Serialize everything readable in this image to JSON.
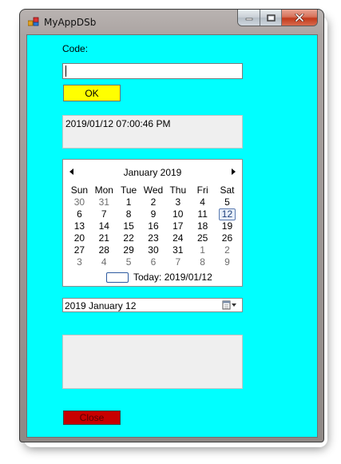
{
  "window": {
    "title": "MyAppDSb"
  },
  "form": {
    "code_label": "Code:",
    "code_value": "",
    "ok_label": "OK",
    "timestamp": "2019/01/12 07:00:46 PM",
    "close_label": "Close"
  },
  "calendar": {
    "month_title": "January 2019",
    "weekdays": [
      "Sun",
      "Mon",
      "Tue",
      "Wed",
      "Thu",
      "Fri",
      "Sat"
    ],
    "weeks": [
      [
        "30",
        "31",
        "1",
        "2",
        "3",
        "4",
        "5"
      ],
      [
        "6",
        "7",
        "8",
        "9",
        "10",
        "11",
        "12"
      ],
      [
        "13",
        "14",
        "15",
        "16",
        "17",
        "18",
        "19"
      ],
      [
        "20",
        "21",
        "22",
        "23",
        "24",
        "25",
        "26"
      ],
      [
        "27",
        "28",
        "29",
        "30",
        "31",
        "1",
        "2"
      ],
      [
        "3",
        "4",
        "5",
        "6",
        "7",
        "8",
        "9"
      ]
    ],
    "other_month_mask": [
      [
        1,
        1,
        0,
        0,
        0,
        0,
        0
      ],
      [
        0,
        0,
        0,
        0,
        0,
        0,
        0
      ],
      [
        0,
        0,
        0,
        0,
        0,
        0,
        0
      ],
      [
        0,
        0,
        0,
        0,
        0,
        0,
        0
      ],
      [
        0,
        0,
        0,
        0,
        0,
        1,
        1
      ],
      [
        1,
        1,
        1,
        1,
        1,
        1,
        1
      ]
    ],
    "selected_day": "12",
    "today_text": "Today: 2019/01/12"
  },
  "date_picker": {
    "value": "2019   January   12"
  },
  "colors": {
    "client_bg": "#00ffff",
    "ok_button": "#ffff00",
    "close_button": "#c80000"
  }
}
